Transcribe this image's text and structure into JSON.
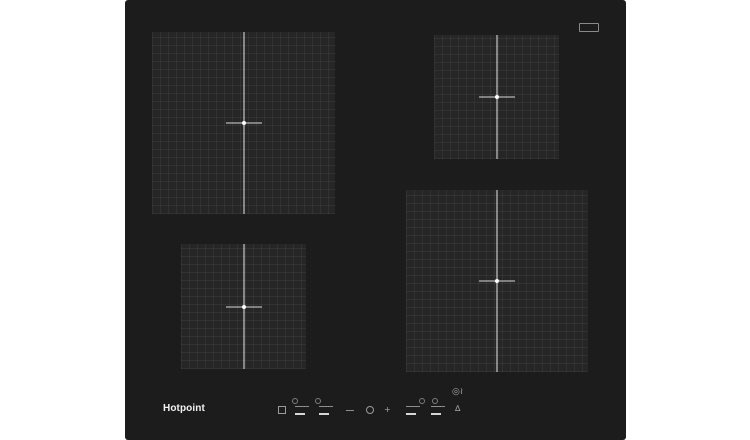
{
  "product": {
    "brand": "Hotpoint",
    "type": "induction hob",
    "surface_color": "#1c1c1c",
    "zones": [
      {
        "name": "front-left"
      },
      {
        "name": "rear-left"
      },
      {
        "name": "front-right"
      },
      {
        "name": "rear-right"
      }
    ]
  },
  "controls": {
    "icons": [
      "power-icon",
      "minus-icon",
      "plus-icon",
      "booster-icon",
      "timer-icon",
      "lock-icon",
      "wifi-icon"
    ]
  }
}
